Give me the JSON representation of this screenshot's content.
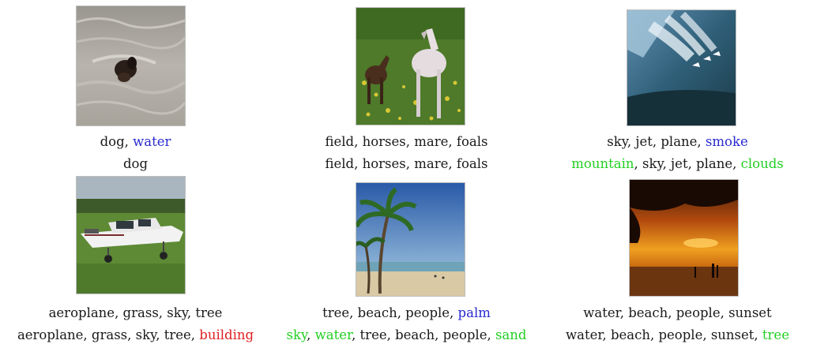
{
  "colors": {
    "text": "#1a1a1a",
    "blue": "#2a2ad0",
    "green": "#22d022",
    "red": "#e02020"
  },
  "panels": [
    {
      "image": "dog-swimming-photo",
      "line1": [
        {
          "t": "dog, ",
          "c": "text"
        },
        {
          "t": "water",
          "c": "blue"
        }
      ],
      "line2": [
        {
          "t": "dog",
          "c": "text"
        }
      ]
    },
    {
      "image": "horses-in-field-photo",
      "line1": [
        {
          "t": "field, horses, mare, foals",
          "c": "text"
        }
      ],
      "line2": [
        {
          "t": "field, horses, mare, foals",
          "c": "text"
        }
      ]
    },
    {
      "image": "jets-in-sky-photo",
      "line1": [
        {
          "t": "sky, jet, plane, ",
          "c": "text"
        },
        {
          "t": "smoke",
          "c": "blue"
        }
      ],
      "line2": [
        {
          "t": "mountain",
          "c": "green"
        },
        {
          "t": ", sky, jet, plane, ",
          "c": "text"
        },
        {
          "t": "clouds",
          "c": "green"
        }
      ]
    },
    {
      "image": "propeller-plane-on-grass-photo",
      "line1": [
        {
          "t": "aeroplane, grass, sky, tree",
          "c": "text"
        }
      ],
      "line2": [
        {
          "t": "aeroplane, grass, sky, tree, ",
          "c": "text"
        },
        {
          "t": "building",
          "c": "red"
        }
      ]
    },
    {
      "image": "palm-beach-photo",
      "line1": [
        {
          "t": "tree, beach, people, ",
          "c": "text"
        },
        {
          "t": "palm",
          "c": "blue"
        }
      ],
      "line2": [
        {
          "t": "sky",
          "c": "green"
        },
        {
          "t": ", ",
          "c": "text"
        },
        {
          "t": "water",
          "c": "green"
        },
        {
          "t": ", tree, beach, people, ",
          "c": "text"
        },
        {
          "t": "sand",
          "c": "green"
        }
      ]
    },
    {
      "image": "sunset-beach-photo",
      "line1": [
        {
          "t": "water, beach, people, sunset",
          "c": "text"
        }
      ],
      "line2": [
        {
          "t": "water, beach, people, sunset, ",
          "c": "text"
        },
        {
          "t": "tree",
          "c": "green"
        }
      ]
    }
  ]
}
